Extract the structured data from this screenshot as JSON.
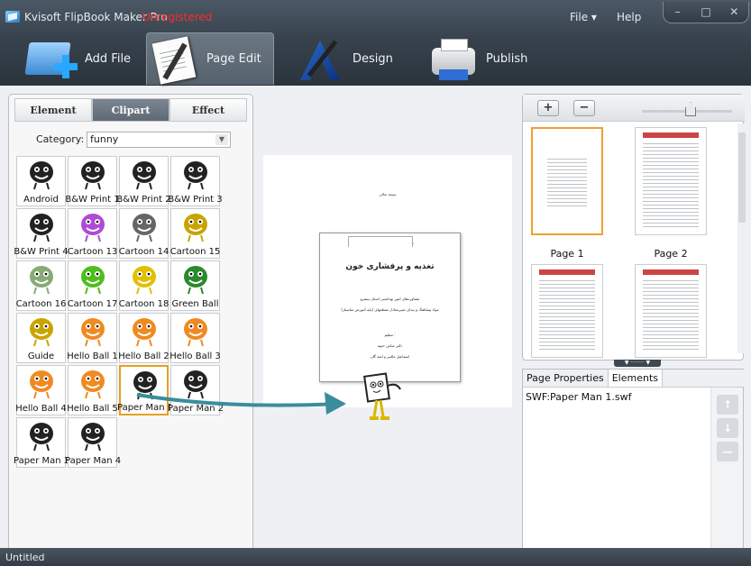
{
  "titlebar": {
    "app_title": "Kvisoft FlipBook Maker Pro",
    "unregistered": "Unregistered",
    "menu_file": "File ▾",
    "menu_help": "Help",
    "win_min": "–",
    "win_max": "□",
    "win_close": "✕"
  },
  "toolbar": {
    "add_file": "Add File",
    "page_edit": "Page Edit",
    "design": "Design",
    "publish": "Publish"
  },
  "left_panel": {
    "tabs": [
      "Element",
      "Clipart",
      "Effect"
    ],
    "active_tab": "Clipart",
    "category_label": "Category:",
    "category_value": "funny",
    "cliparts": [
      "Android",
      "B&W Print 1",
      "B&W Print 2",
      "B&W Print 3",
      "B&W Print 4",
      "Cartoon 13",
      "Cartoon 14",
      "Cartoon 15",
      "Cartoon 16",
      "Cartoon 17",
      "Cartoon 18",
      "Green Ball",
      "Guide",
      "Hello Ball 1",
      "Hello Ball 2",
      "Hello Ball 3",
      "Hello Ball 4",
      "Hello Ball 5",
      "Paper Man 1",
      "Paper Man 2",
      "Paper Man 3",
      "Paper Man 4"
    ],
    "selected_clipart": "Paper Man 1"
  },
  "stage": {
    "header_text": "بسمه تعالی",
    "page_subtitle": "شاگل دوش خود را بدای بیاوریم",
    "page_title": "تغذیه و پرفشاری خون",
    "page_line1": "مشاوره‌های امور بهداشتی استان پیشرو",
    "page_line2": "مواد پیشاهنگ و بیدای تغییرمعادل مقطعهای (پایه آموزش متاستاز)",
    "page_line3": "تنظیم :",
    "page_line4": "دکتر عباس حبیبه",
    "page_line5": "اسماعیل مالیبر و اسه گان"
  },
  "thumbs": {
    "zoom_in": "+",
    "zoom_out": "−",
    "pages": [
      "Page 1",
      "Page 2"
    ],
    "selected_page": "Page 1"
  },
  "props": {
    "tabs": [
      "Page Properties",
      "Elements"
    ],
    "active_tab": "Elements",
    "elements": [
      "SWF:Paper Man 1.swf"
    ],
    "move_up": "↑",
    "move_down": "↓",
    "remove": "—"
  },
  "status": {
    "text": "Untitled"
  },
  "colors": {
    "accent_selection": "#e5a020",
    "unregistered_red": "#ff2b2b",
    "arrow_teal": "#3a8d9c"
  }
}
